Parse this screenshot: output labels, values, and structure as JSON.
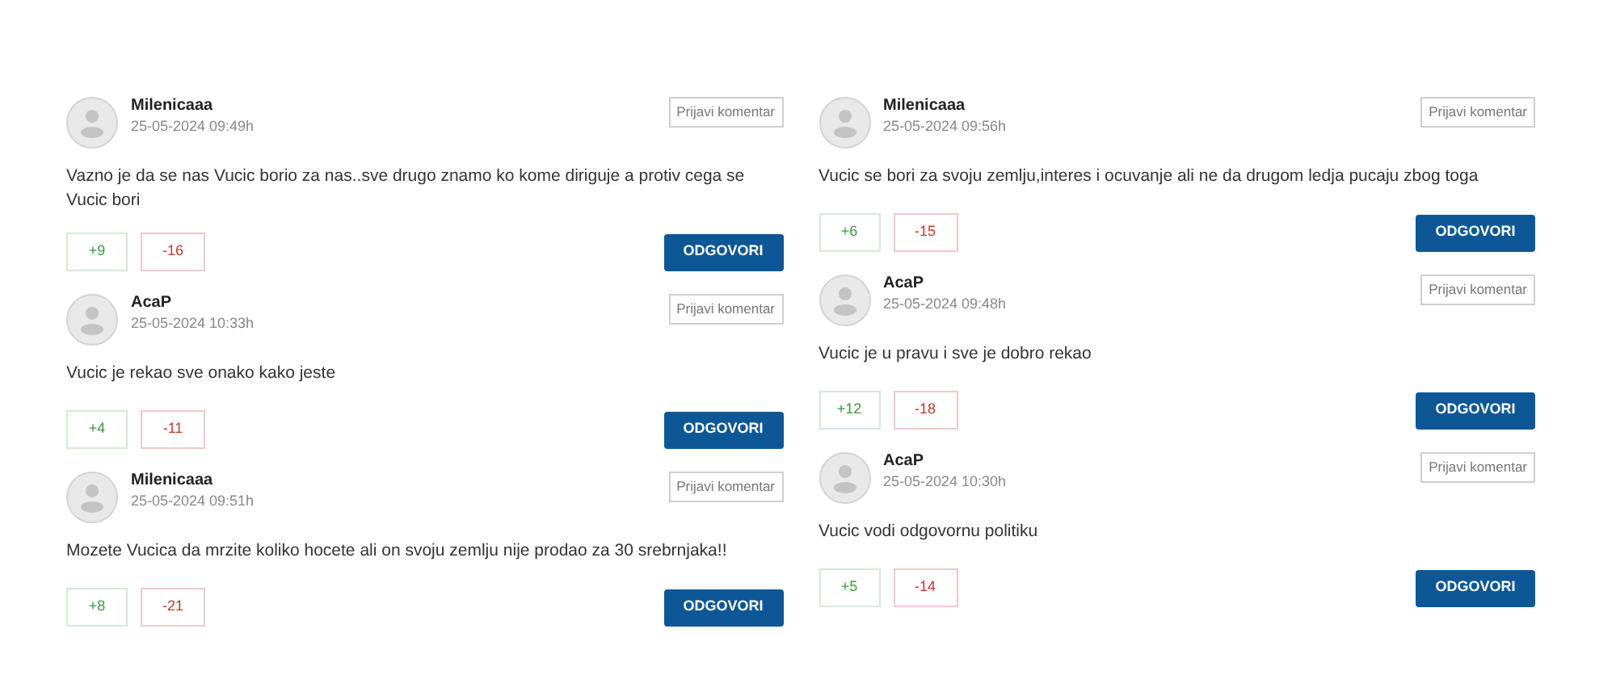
{
  "columns": [
    {
      "comments": [
        {
          "author": "Milenicaaa",
          "date": "25-05-2024 09:49h",
          "report": "Prijavi komentar",
          "text": "Vazno je da se nas Vucic borio za nas..sve drugo znamo ko kome diriguje a protiv cega se Vucic bori",
          "upvotes": "+9",
          "downvotes": "-16",
          "reply": "ODGOVORI"
        },
        {
          "author": "AcaP",
          "date": "25-05-2024 10:33h",
          "report": "Prijavi komentar",
          "text": "Vucic je rekao sve onako kako jeste",
          "upvotes": "+4",
          "downvotes": "-11",
          "reply": "ODGOVORI"
        },
        {
          "author": "Milenicaaa",
          "date": "25-05-2024 09:51h",
          "report": "Prijavi komentar",
          "text": "Mozete Vucica da mrzite koliko hocete ali on svoju zemlju nije prodao za 30 srebrnjaka!!",
          "upvotes": "+8",
          "downvotes": "-21",
          "reply": "ODGOVORI"
        }
      ]
    },
    {
      "comments": [
        {
          "author": "Milenicaaa",
          "date": "25-05-2024 09:56h",
          "report": "Prijavi komentar",
          "text": "Vucic se bori za svoju zemlju,interes i ocuvanje ali ne da drugom ledja pucaju zbog toga",
          "upvotes": "+6",
          "downvotes": "-15",
          "reply": "ODGOVORI"
        },
        {
          "author": "AcaP",
          "date": "25-05-2024 09:48h",
          "report": "Prijavi komentar",
          "text": "Vucic je u pravu i sve je dobro rekao",
          "upvotes": "+12",
          "downvotes": "-18",
          "reply": "ODGOVORI"
        },
        {
          "author": "AcaP",
          "date": "25-05-2024 10:30h",
          "report": "Prijavi komentar",
          "text": "Vucic vodi odgovornu politiku",
          "upvotes": "+5",
          "downvotes": "-14",
          "reply": "ODGOVORI"
        }
      ]
    }
  ]
}
